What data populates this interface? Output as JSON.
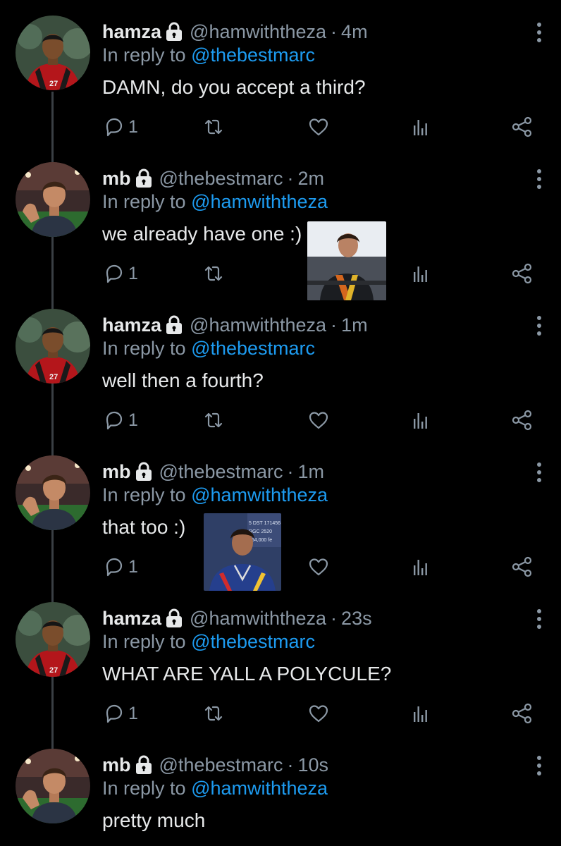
{
  "accent_color": "#1d9bf0",
  "muted_color": "#8b98a5",
  "reply_prefix": "In reply to",
  "tweets": [
    {
      "name": "hamza",
      "handle": "@hamwiththeza",
      "separator": "·",
      "time": "4m",
      "reply_to": "@thebestmarc",
      "text": "DAMN, do you accept a third?",
      "reply_count": "1",
      "avatar": "hamza-avatar"
    },
    {
      "name": "mb",
      "handle": "@thebestmarc",
      "separator": "·",
      "time": "2m",
      "reply_to": "@hamwiththeza",
      "text": "we already have one :)",
      "reply_count": "1",
      "avatar": "mb-avatar",
      "media": "photo-thumbnail"
    },
    {
      "name": "hamza",
      "handle": "@hamwiththeza",
      "separator": "·",
      "time": "1m",
      "reply_to": "@thebestmarc",
      "text": "well then a fourth?",
      "reply_count": "1",
      "avatar": "hamza-avatar"
    },
    {
      "name": "mb",
      "handle": "@thebestmarc",
      "separator": "·",
      "time": "1m",
      "reply_to": "@hamwiththeza",
      "text": "that too :)",
      "reply_count": "1",
      "avatar": "mb-avatar",
      "media": "photo-thumbnail"
    },
    {
      "name": "hamza",
      "handle": "@hamwiththeza",
      "separator": "·",
      "time": "23s",
      "reply_to": "@thebestmarc",
      "text": "WHAT ARE YALL A POLYCULE?",
      "reply_count": "1",
      "avatar": "hamza-avatar"
    },
    {
      "name": "mb",
      "handle": "@thebestmarc",
      "separator": "·",
      "time": "10s",
      "reply_to": "@hamwiththeza",
      "text": "pretty much",
      "avatar": "mb-avatar"
    }
  ],
  "icons": {
    "reply": "reply-icon",
    "retweet": "retweet-icon",
    "like": "like-icon",
    "analytics": "analytics-icon",
    "share": "share-icon",
    "more": "more-vertical-icon",
    "lock": "lock-icon"
  }
}
